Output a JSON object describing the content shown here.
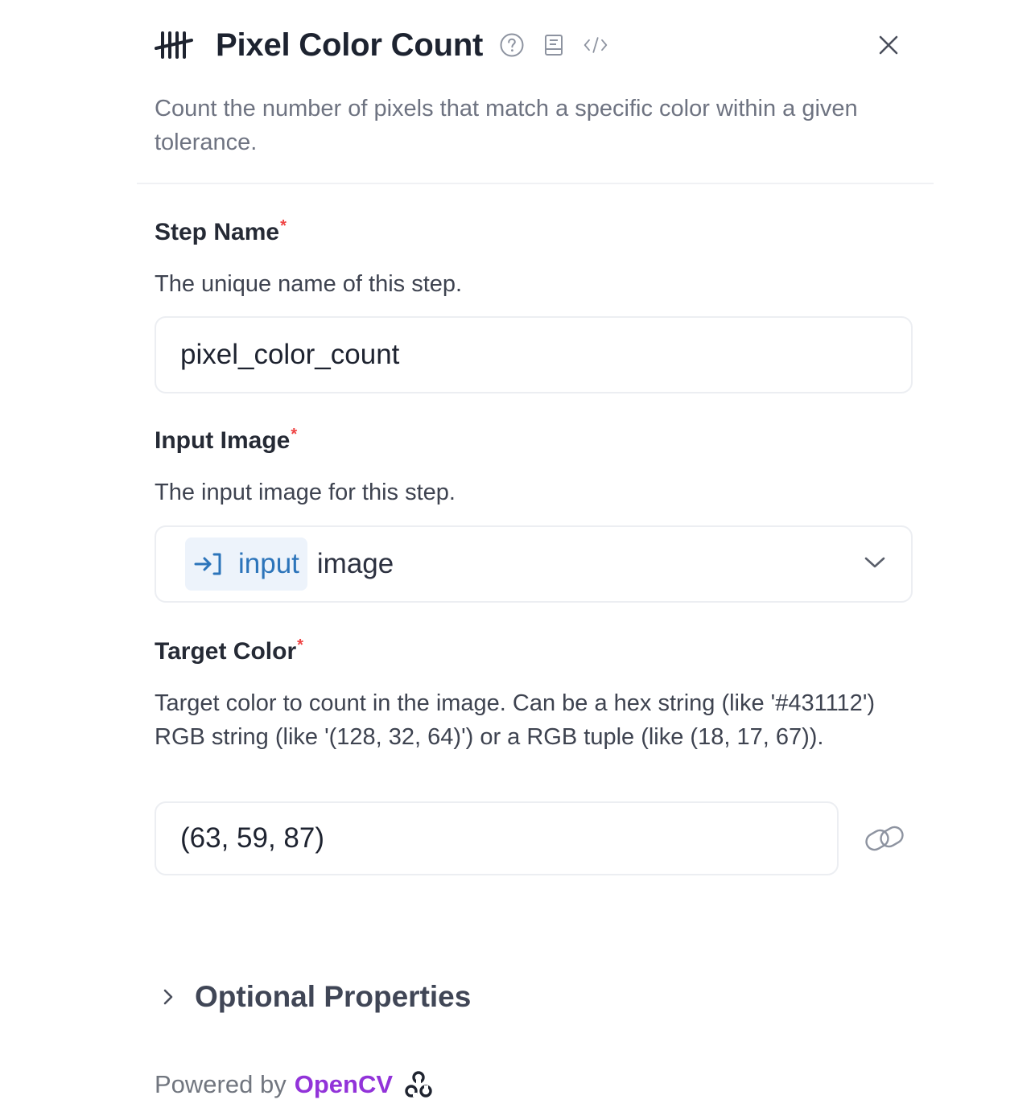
{
  "header": {
    "title": "Pixel Color Count",
    "icons": [
      "tally-icon",
      "help-circle-icon",
      "book-icon",
      "code-icon",
      "close-icon"
    ]
  },
  "description": "Count the number of pixels that match a specific color within a given tolerance.",
  "fields": {
    "step_name": {
      "label": "Step Name",
      "required_marker": "*",
      "help": "The unique name of this step.",
      "value": "pixel_color_count"
    },
    "input_image": {
      "label": "Input Image",
      "required_marker": "*",
      "help": "The input image for this step.",
      "chip_label": "input",
      "value": "image"
    },
    "target_color": {
      "label": "Target Color",
      "required_marker": "*",
      "help": "Target color to count in the image. Can be a hex string (like '#431112') RGB string (like '(128, 32, 64)') or a RGB tuple (like (18, 17, 67)).",
      "value": "(63, 59, 87)"
    }
  },
  "optional_properties": {
    "label": "Optional Properties"
  },
  "footer": {
    "powered_by": "Powered by",
    "library": "OpenCV"
  },
  "colors": {
    "accent_blue": "#2c74ba",
    "chip_bg": "#edf3fb",
    "required_red": "#ef4444",
    "opencv_purple": "#9233d9"
  }
}
